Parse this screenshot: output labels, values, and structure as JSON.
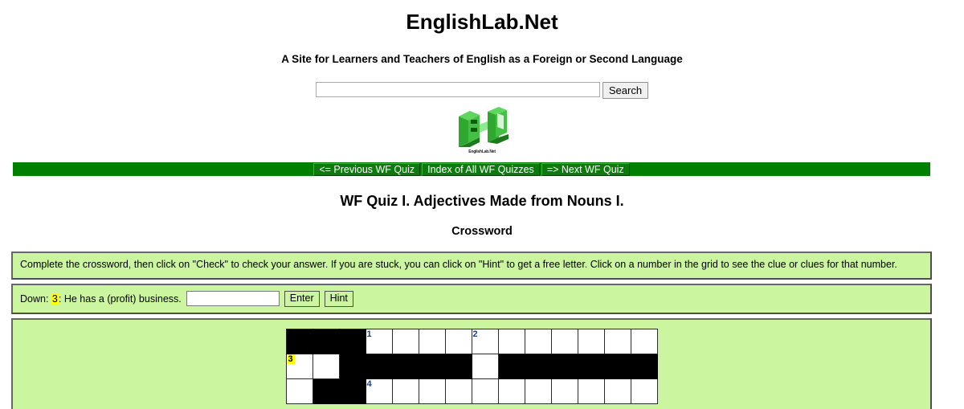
{
  "header": {
    "site_title": "EnglishLab.Net",
    "tagline": "A Site for Learners and Teachers of English as a Foreign or Second Language",
    "logo_caption": "EnglishLab.Net",
    "logo_icon": "el-cube-logo-icon"
  },
  "search": {
    "value": "",
    "placeholder": "",
    "button_label": "Search"
  },
  "nav": {
    "items": [
      {
        "label": "<= Previous WF Quiz"
      },
      {
        "label": "Index of All WF Quizzes"
      },
      {
        "label": "=> Next WF Quiz"
      }
    ],
    "bar_color": "#008000"
  },
  "quiz": {
    "title": "WF Quiz I. Adjectives Made from Nouns I.",
    "subtitle": "Crossword"
  },
  "instructions": {
    "text": "Complete the crossword, then click on \"Check\" to check your answer. If you are stuck, you can click on \"Hint\" to get a free letter. Click on a number in the grid to see the clue or clues for that number."
  },
  "clue": {
    "direction_label": "Down:",
    "number": "3",
    "separator": ":",
    "text": "He has a (profit) business.",
    "answer_value": "",
    "answer_placeholder": "",
    "enter_label": "Enter",
    "hint_label": "Hint",
    "highlight_color": "#ffff00"
  },
  "crossword": {
    "columns": 14,
    "rows": 3,
    "cell_numbers": {
      "r1c4": "1",
      "r1c8": "2",
      "r2c1": "3",
      "r3c4": "4"
    },
    "highlighted_number": "3",
    "rows_data": [
      [
        "blk",
        "blk",
        "blk",
        "open",
        "open",
        "open",
        "open",
        "open",
        "open",
        "open",
        "open",
        "open",
        "open",
        "open"
      ],
      [
        "open",
        "open",
        "blk",
        "blk",
        "blk",
        "blk",
        "blk",
        "open",
        "blk",
        "blk",
        "blk",
        "blk",
        "blk",
        "blk"
      ],
      [
        "open",
        "blk",
        "blk",
        "open",
        "open",
        "open",
        "open",
        "open",
        "open",
        "open",
        "open",
        "open",
        "open",
        "open"
      ]
    ]
  },
  "colors": {
    "panel_bg": "#ccf5a0",
    "panel_border": "#4d4d4d",
    "nav_green": "#008000",
    "logo_green": "#3ecb3e"
  }
}
